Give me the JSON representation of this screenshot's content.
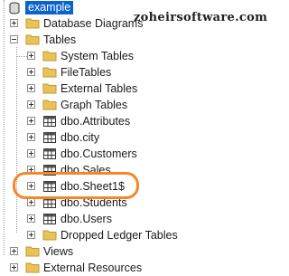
{
  "watermark": "zoheirsoftware.com",
  "tree": {
    "root": {
      "label": "example",
      "selected": true
    },
    "database_diagrams": {
      "label": "Database Diagrams"
    },
    "tables": {
      "label": "Tables",
      "folders": [
        {
          "label": "System Tables"
        },
        {
          "label": "FileTables"
        },
        {
          "label": "External Tables"
        },
        {
          "label": "Graph Tables"
        }
      ],
      "items": [
        {
          "label": "dbo.Attributes"
        },
        {
          "label": "dbo.city"
        },
        {
          "label": "dbo.Customers"
        },
        {
          "label": "dbo.Sales"
        },
        {
          "label": "dbo.Sheet1$",
          "highlighted": true
        },
        {
          "label": "dbo.Students"
        },
        {
          "label": "dbo.Users"
        }
      ],
      "dropped": {
        "label": "Dropped Ledger Tables"
      }
    },
    "views": {
      "label": "Views"
    },
    "external_resources": {
      "label": "External Resources"
    }
  },
  "colors": {
    "selection": "#0b63ce",
    "highlight_ring": "#f5862a",
    "folder": "#e8c25a"
  }
}
